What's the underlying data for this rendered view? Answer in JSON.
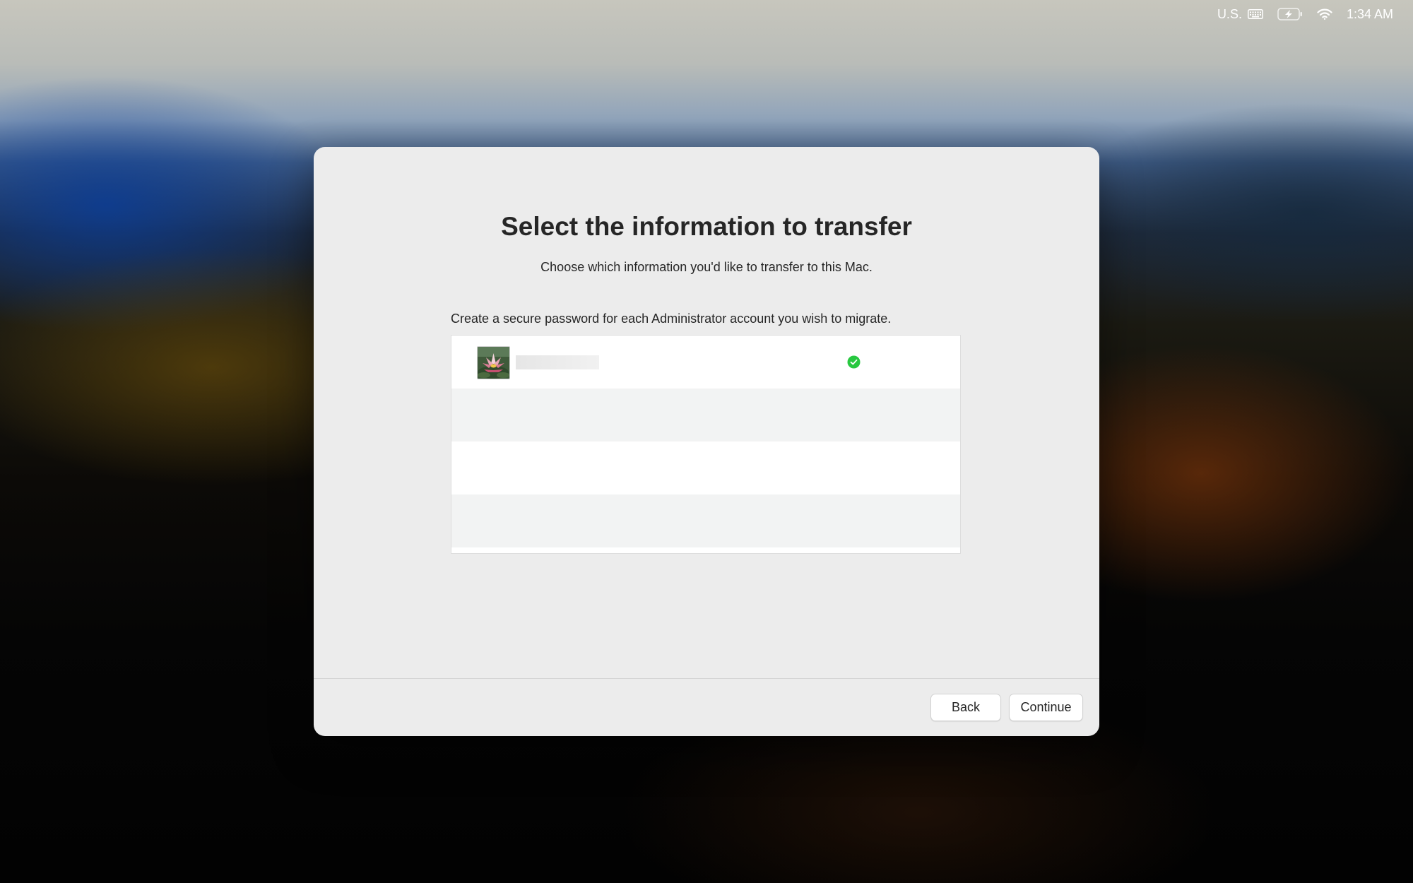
{
  "menubar": {
    "input_source": "U.S.",
    "clock": "1:34 AM",
    "icons": [
      "keyboard-icon",
      "battery-charging-icon",
      "wifi-icon"
    ]
  },
  "dialog": {
    "title": "Select the information to transfer",
    "subtitle": "Choose which information you'd like to transfer to this Mac.",
    "instruction": "Create a secure password for each Administrator account you wish to migrate.",
    "accounts": [
      {
        "avatar": "water-lily-photo",
        "name": "",
        "status": "checkmark-ok"
      }
    ],
    "status_color": "#28c840",
    "buttons": {
      "back": "Back",
      "continue": "Continue"
    }
  }
}
